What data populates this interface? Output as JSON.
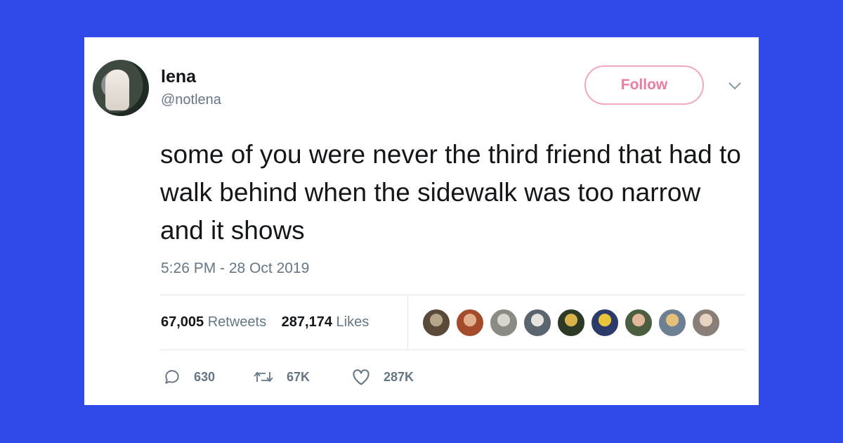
{
  "tweet": {
    "author_name": "lena",
    "author_handle": "@notlena",
    "follow_label": "Follow",
    "text": "some of you were never the third friend that had to walk behind when the sidewalk was too narrow and it shows",
    "timestamp": "5:26 PM - 28 Oct 2019"
  },
  "stats": {
    "retweets_count": "67,005",
    "retweets_label": "Retweets",
    "likes_count": "287,174",
    "likes_label": "Likes"
  },
  "actions": {
    "replies": "630",
    "retweets": "67K",
    "likes": "287K"
  },
  "icons": [
    "chevron-down-icon",
    "reply-icon",
    "retweet-icon",
    "heart-icon"
  ],
  "colors": {
    "background": "#2f4ae9",
    "card": "#ffffff",
    "follow_accent": "#ea7ca3",
    "muted_text": "#657786"
  }
}
